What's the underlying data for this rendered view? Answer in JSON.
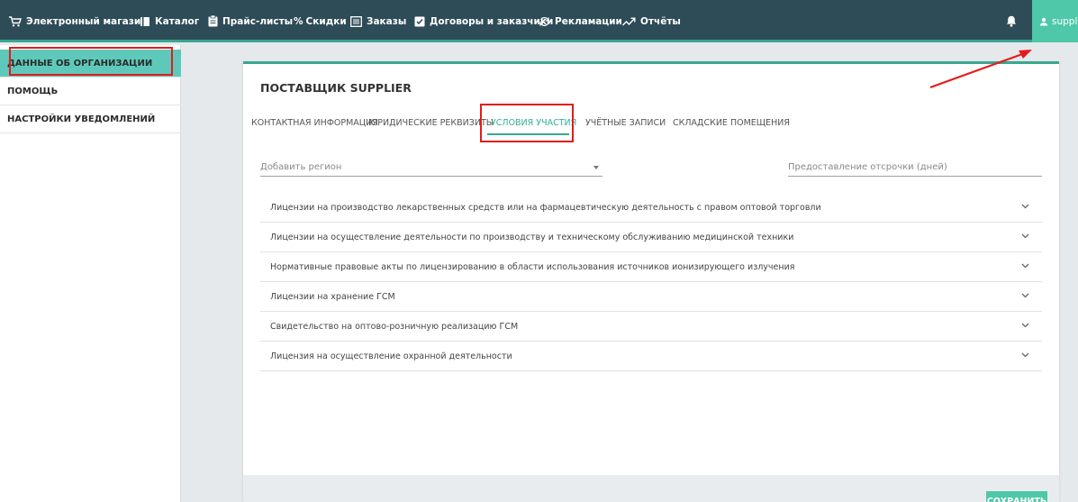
{
  "nav": {
    "items": [
      {
        "label": "Электронный магазин",
        "icon": "cart-icon"
      },
      {
        "label": "Каталог",
        "icon": "book-icon"
      },
      {
        "label": "Прайс-листы",
        "icon": "clipboard-icon"
      },
      {
        "label": "Скидки",
        "icon": "percent-icon"
      },
      {
        "label": "Заказы",
        "icon": "list-icon"
      },
      {
        "label": "Договоры и заказчики",
        "icon": "check-clipboard-icon"
      },
      {
        "label": "Рекламации",
        "icon": "refresh-icon"
      },
      {
        "label": "Отчёты",
        "icon": "trend-icon"
      }
    ],
    "user_label": "supplier",
    "percent_symbol": "%"
  },
  "sidebar": {
    "items": [
      {
        "label": "ДАННЫЕ ОБ ОРГАНИЗАЦИИ",
        "active": true
      },
      {
        "label": "ПОМОЩЬ",
        "active": false
      },
      {
        "label": "НАСТРОЙКИ УВЕДОМЛЕНИЙ",
        "active": false
      }
    ]
  },
  "card": {
    "title": "ПОСТАВЩИК SUPPLIER",
    "tabs": [
      {
        "label": "КОНТАКТНАЯ ИНФОРМАЦИЯ",
        "active": false
      },
      {
        "label": "ЮРИДИЧЕСКИЕ РЕКВИЗИТЫ",
        "active": false
      },
      {
        "label": "УСЛОВИЯ УЧАСТИЯ",
        "active": true
      },
      {
        "label": "УЧЁТНЫЕ ЗАПИСИ",
        "active": false
      },
      {
        "label": "СКЛАДСКИЕ ПОМЕЩЕНИЯ",
        "active": false
      }
    ],
    "region_placeholder": "Добавить регион",
    "delay_placeholder": "Предоставление отсрочки (дней)",
    "licenses": [
      "Лицензии на производство лекарственных средств или на фармацевтическую деятельность с правом оптовой торговли",
      "Лицензии на осуществление деятельности по производству и техническому обслуживанию медицинской техники",
      "Нормативные правовые акты по лицензированию в области использования источников ионизирующего излучения",
      "Лицензии на хранение ГСМ",
      "Свидетельство на оптово-розничную реализацию ГСМ",
      "Лицензия на осуществление охранной деятельности"
    ],
    "save_label": "СОХРАНИТЬ"
  },
  "colors": {
    "topbar": "#2e4c57",
    "accent": "#4ec8a8",
    "active_sidebar": "#5ec9ba",
    "highlight": "#e31b1b"
  }
}
